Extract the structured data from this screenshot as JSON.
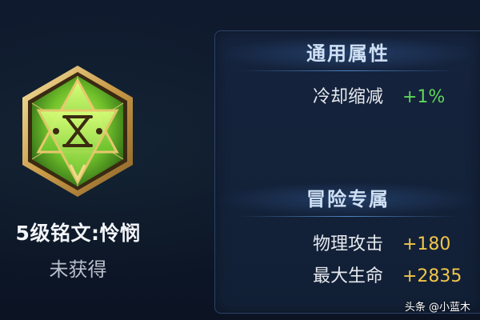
{
  "inscription": {
    "name": "5级铭文:怜悯",
    "status": "未获得",
    "icon": "green-hexagram-inscription-icon"
  },
  "general_section": {
    "title": "通用属性",
    "stats": [
      {
        "label": "冷却缩减",
        "value": "+1%"
      }
    ]
  },
  "adventure_section": {
    "title": "冒险专属",
    "stats": [
      {
        "label": "物理攻击",
        "value": "+180"
      },
      {
        "label": "最大生命",
        "value": "+2835"
      }
    ]
  },
  "watermark": "头条 @小蓝木",
  "colors": {
    "general_value": "#5fd75a",
    "adventure_value": "#f2c54a",
    "header_text": "#cfe0f5",
    "panel_bg": "#15233d"
  }
}
